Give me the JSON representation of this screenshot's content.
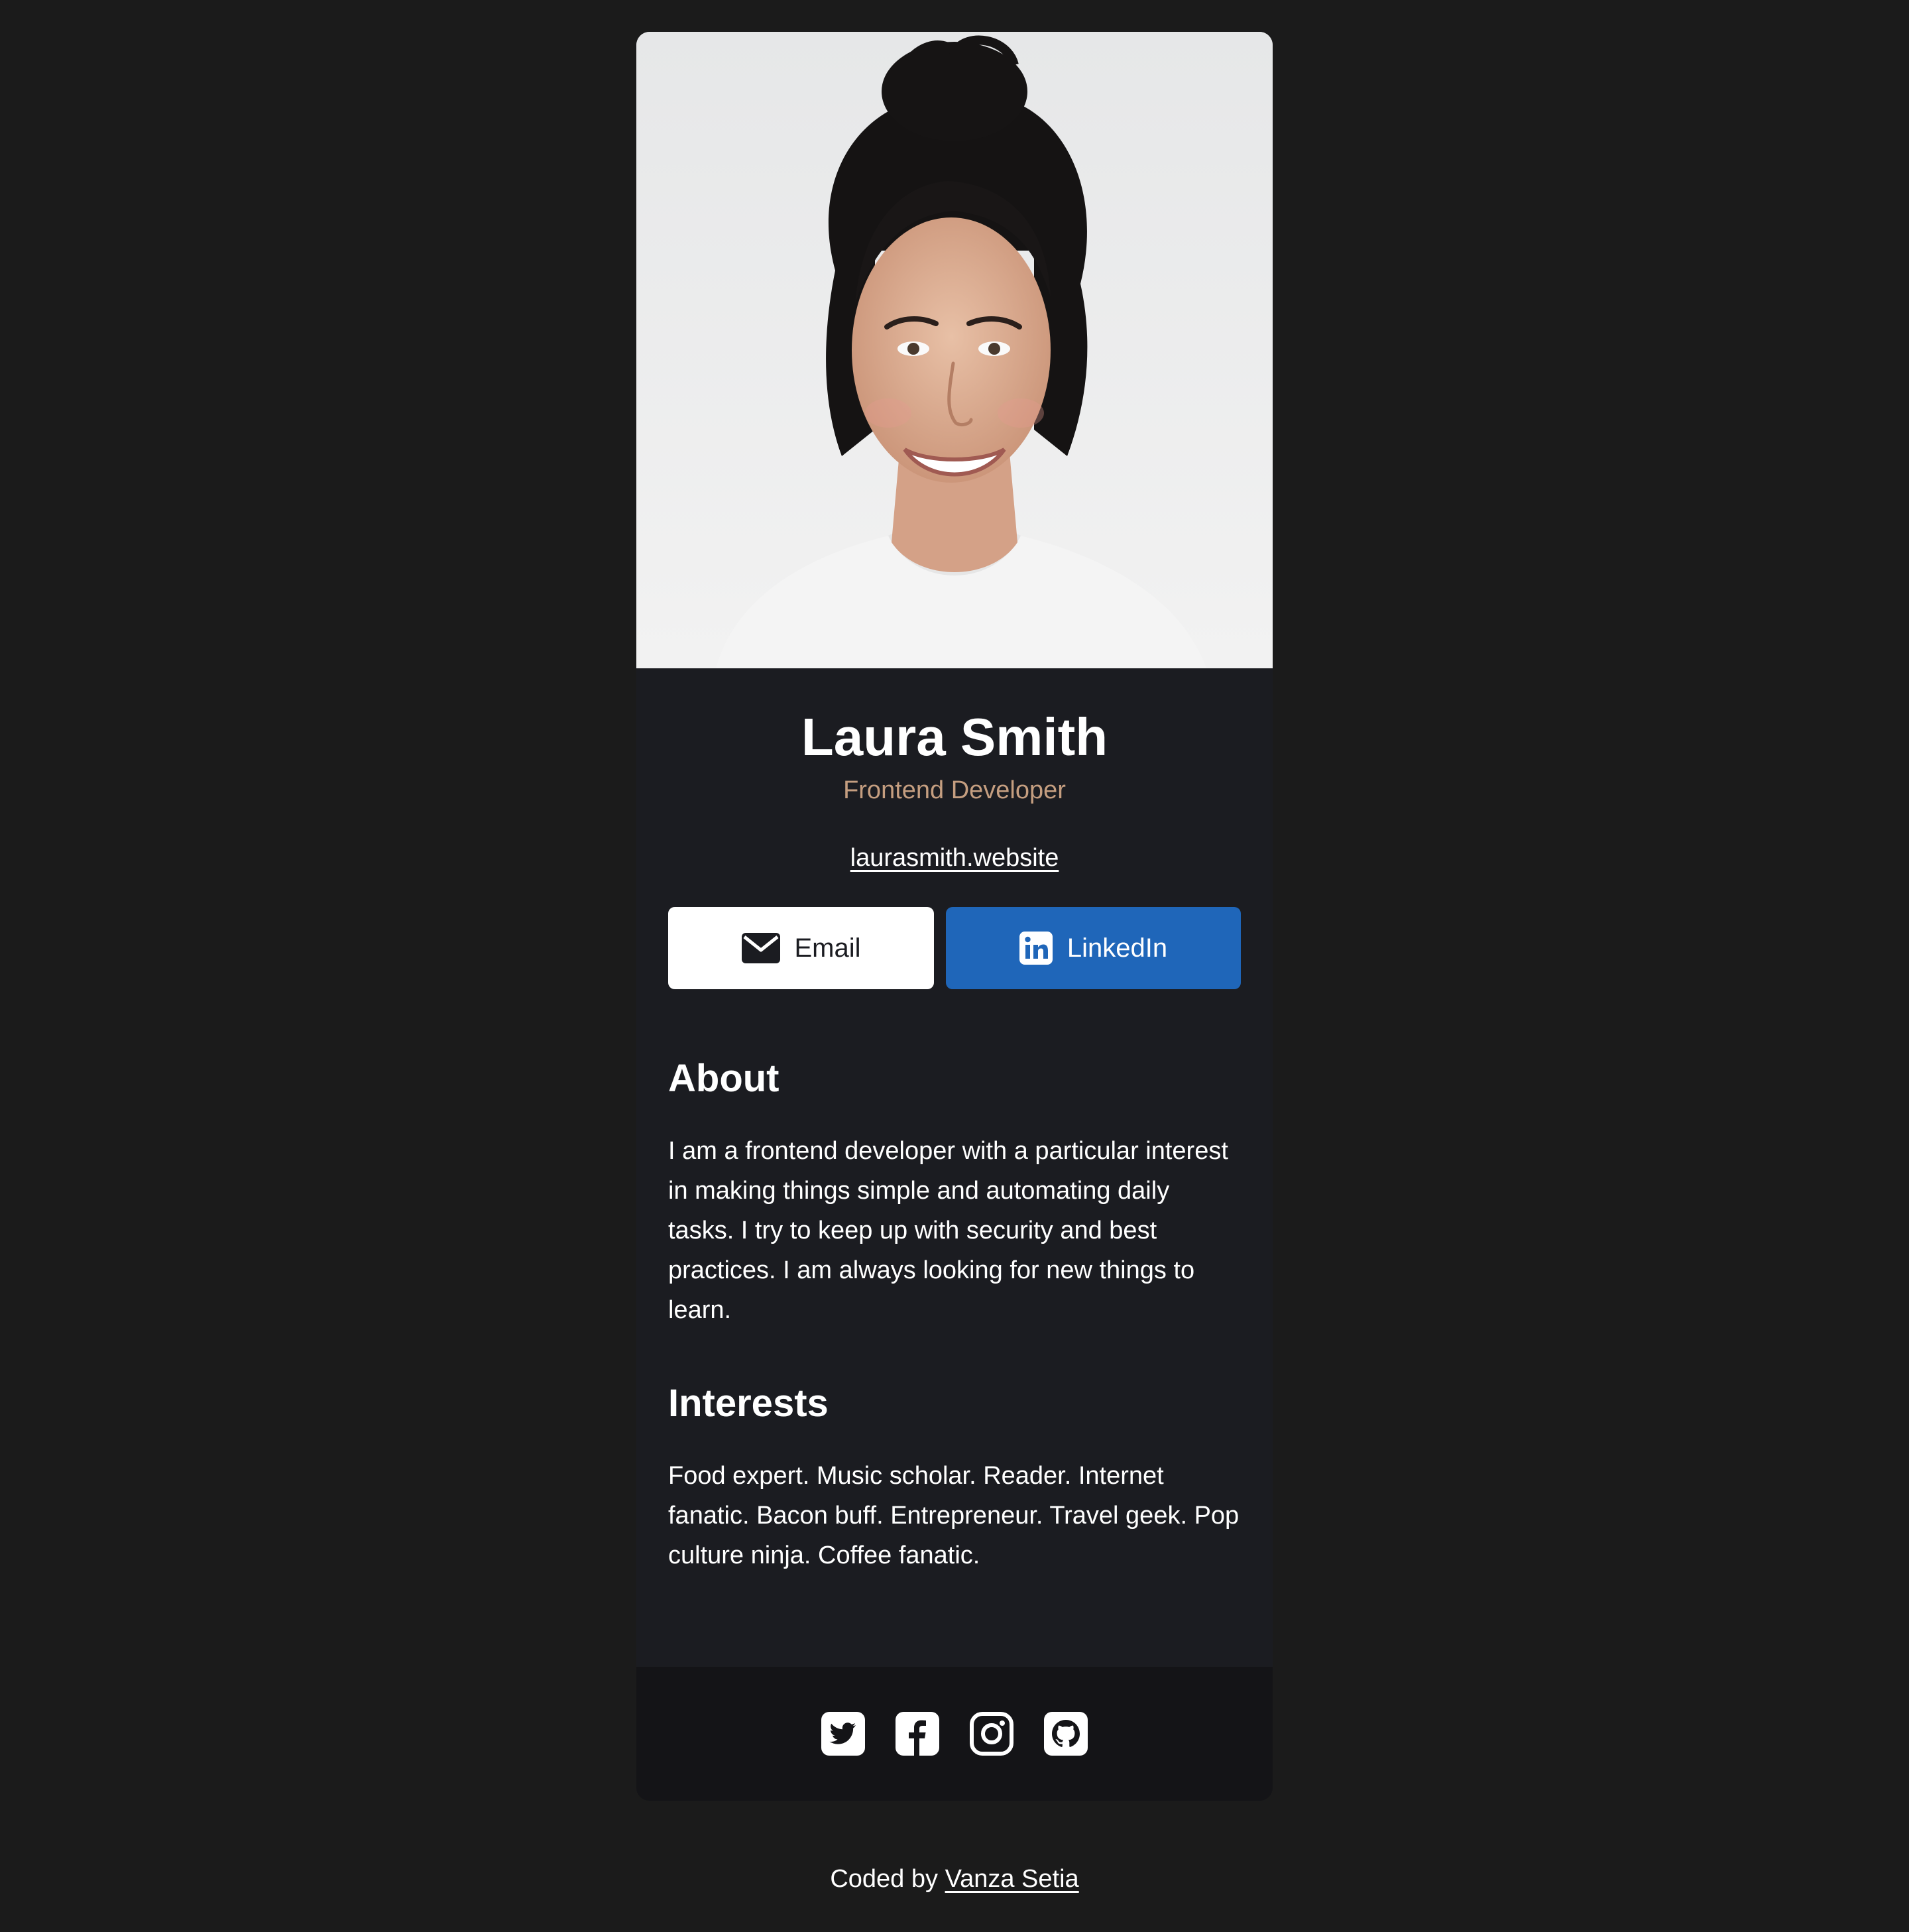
{
  "profile": {
    "name": "Laura Smith",
    "title": "Frontend Developer",
    "website": "laurasmith.website"
  },
  "actions": {
    "email_label": "Email",
    "linkedin_label": "LinkedIn"
  },
  "about": {
    "heading": "About",
    "text": "I am a frontend developer with a particular interest in making things simple and automating daily tasks. I try to keep up with security and best practices. I am always looking for new things to learn."
  },
  "interests": {
    "heading": "Interests",
    "text": "Food expert. Music scholar. Reader. Internet fanatic. Bacon buff. Entrepreneur. Travel geek. Pop culture ninja. Coffee fanatic."
  },
  "social_links": [
    {
      "icon": "twitter-icon"
    },
    {
      "icon": "facebook-icon"
    },
    {
      "icon": "instagram-icon"
    },
    {
      "icon": "github-icon"
    }
  ],
  "footer": {
    "prefix": "Coded by",
    "author": "Vanza Setia"
  },
  "colors": {
    "page_background": "#1b1b1b",
    "card_background": "#1b1c21",
    "footer_bar_background": "#141417",
    "accent_role": "#c59e80",
    "linkedin_blue": "#1f66b9"
  }
}
